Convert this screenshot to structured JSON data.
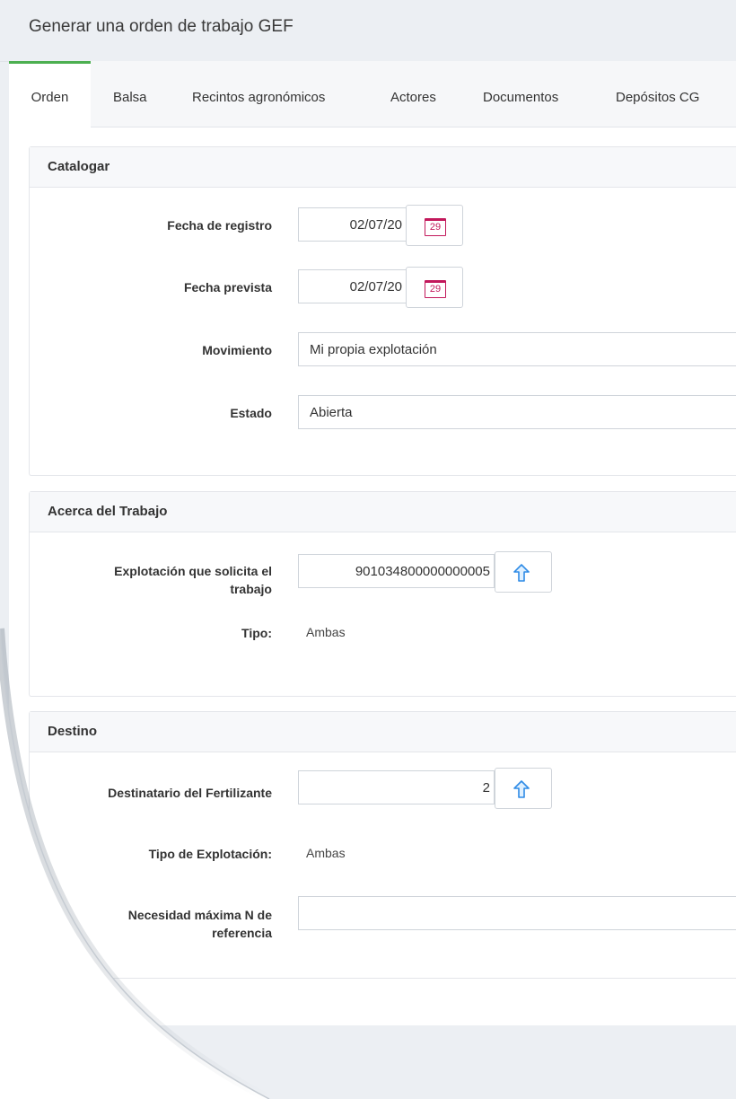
{
  "page_title": "Generar una orden de trabajo GEF",
  "tabs": [
    {
      "label": "Orden",
      "active": true
    },
    {
      "label": "Balsa"
    },
    {
      "label": "Recintos agronómicos"
    },
    {
      "label": "Actores"
    },
    {
      "label": "Documentos"
    },
    {
      "label": "Depósitos CG"
    }
  ],
  "catalogar": {
    "header": "Catalogar",
    "fecha_registro_label": "Fecha de registro",
    "fecha_registro_value": "02/07/20",
    "fecha_prevista_label": "Fecha prevista",
    "fecha_prevista_value": "02/07/20",
    "calendar_day": "29",
    "movimiento_label": "Movimiento",
    "movimiento_value": "Mi propia explotación",
    "estado_label": "Estado",
    "estado_value": "Abierta"
  },
  "acerca": {
    "header": "Acerca del Trabajo",
    "explotacion_label_1": "Explotación que solicita el",
    "explotacion_label_2": "trabajo",
    "explotacion_value": "901034800000000005",
    "tipo_label": "Tipo:",
    "tipo_value": "Ambas"
  },
  "destino": {
    "header": "Destino",
    "destinatario_label": "Destinatario del Fertilizante",
    "destinatario_value": "2",
    "tipo_explotacion_label": "Tipo de Explotación:",
    "tipo_explotacion_value": "Ambas",
    "necesidad_label_1": "Necesidad máxima N de",
    "necesidad_label_2": "referencia",
    "necesidad_value": ""
  },
  "icons": {
    "calendar": "calendar-icon",
    "lookup": "arrow-up-icon"
  },
  "colors": {
    "active_tab": "#4caf50",
    "calendar": "#c2185b",
    "arrow": "#2f8be6"
  }
}
